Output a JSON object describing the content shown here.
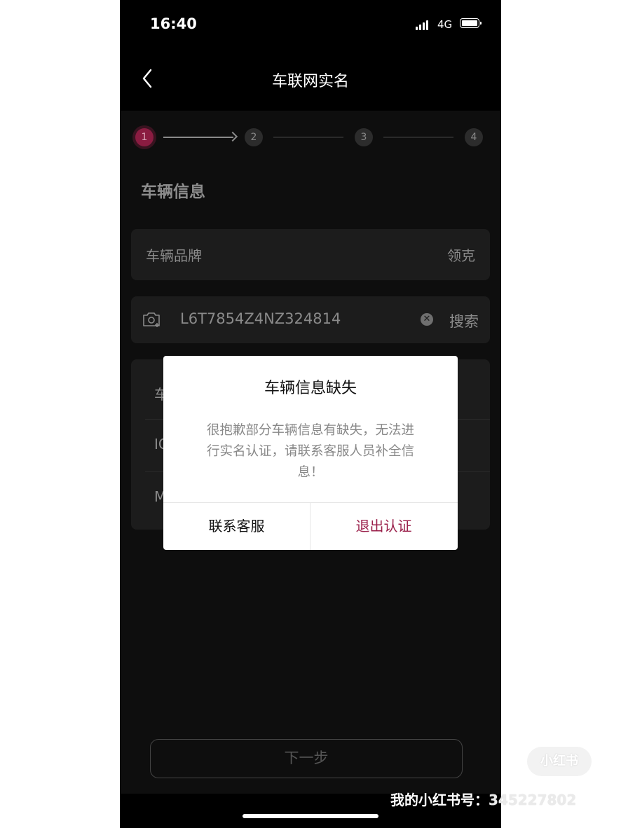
{
  "status_bar": {
    "time": "16:40",
    "network": "4G"
  },
  "nav": {
    "title": "车联网实名"
  },
  "stepper": {
    "steps": [
      "1",
      "2",
      "3",
      "4"
    ],
    "current_step": 1
  },
  "vehicle_info": {
    "section_title": "车辆信息",
    "brand_label": "车辆品牌",
    "brand_value": "领克",
    "vin_value": "L6T7854Z4NZ324814",
    "search_label": "搜索",
    "rows": [
      {
        "label": "车"
      },
      {
        "label": "IC"
      },
      {
        "label": "M"
      }
    ]
  },
  "next_button": {
    "label": "下一步"
  },
  "dialog": {
    "title": "车辆信息缺失",
    "message": "很抱歉部分车辆信息有缺失，无法进行实名认证，请联系客服人员补全信息！",
    "contact_label": "联系客服",
    "exit_label": "退出认证"
  },
  "watermark": {
    "prefix": "我的小红书号：",
    "number": "345227802",
    "logo_text": "小红书"
  },
  "colors": {
    "accent": "#9a1f4a",
    "background": "#000000",
    "card": "#1c1c1c"
  },
  "icons": [
    "back-chevron-icon",
    "camera-scan-icon",
    "clear-icon",
    "signal-icon",
    "battery-icon"
  ]
}
